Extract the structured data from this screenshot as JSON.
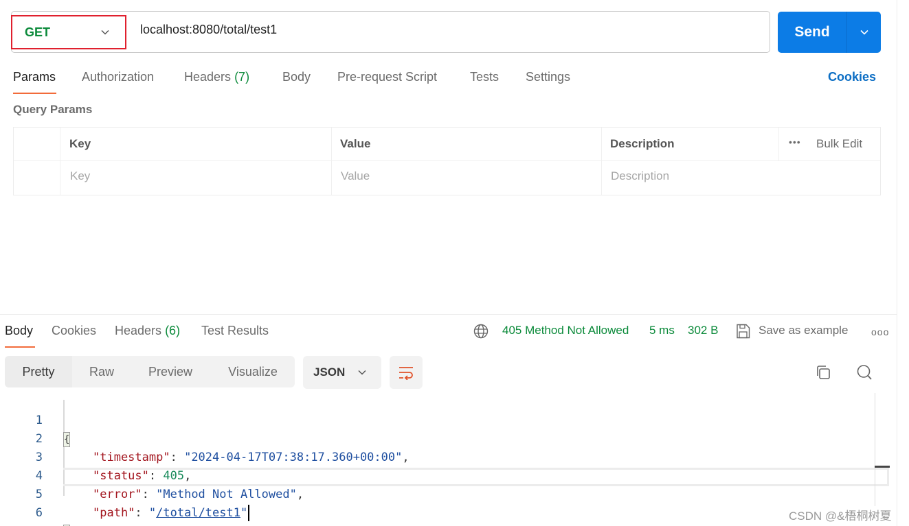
{
  "request": {
    "method": "GET",
    "url": "localhost:8080/total/test1",
    "send_label": "Send",
    "tabs": [
      {
        "label": "Params",
        "count": null,
        "active": true
      },
      {
        "label": "Authorization",
        "count": null,
        "active": false
      },
      {
        "label": "Headers",
        "count": "(7)",
        "active": false
      },
      {
        "label": "Body",
        "count": null,
        "active": false
      },
      {
        "label": "Pre-request Script",
        "count": null,
        "active": false
      },
      {
        "label": "Tests",
        "count": null,
        "active": false
      },
      {
        "label": "Settings",
        "count": null,
        "active": false
      }
    ],
    "cookies_link": "Cookies"
  },
  "params": {
    "section_title": "Query Params",
    "columns": [
      "Key",
      "Value",
      "Description"
    ],
    "bulk_edit": "Bulk Edit",
    "placeholders": {
      "key": "Key",
      "value": "Value",
      "description": "Description"
    }
  },
  "response": {
    "tabs": [
      {
        "label": "Body",
        "count": null,
        "active": true
      },
      {
        "label": "Cookies",
        "count": null,
        "active": false
      },
      {
        "label": "Headers",
        "count": "(6)",
        "active": false
      },
      {
        "label": "Test Results",
        "count": null,
        "active": false
      }
    ],
    "status": "405 Method Not Allowed",
    "time": "5 ms",
    "size": "302 B",
    "save_example": "Save as example",
    "view_modes": [
      "Pretty",
      "Raw",
      "Preview",
      "Visualize"
    ],
    "active_view": "Pretty",
    "format": "JSON",
    "code_lines": [
      {
        "n": "1"
      },
      {
        "n": "2",
        "key": "\"timestamp\"",
        "value": "\"2024-04-17T07:38:17.360+00:00\""
      },
      {
        "n": "3",
        "key": "\"status\"",
        "value": "405"
      },
      {
        "n": "4",
        "key": "\"error\"",
        "value": "\"Method Not Allowed\""
      },
      {
        "n": "5",
        "key": "\"path\"",
        "value": "/total/test1"
      },
      {
        "n": "6"
      }
    ]
  },
  "colors": {
    "accent": "#0c7ce6",
    "success": "#0b8a3a",
    "tab_underline": "#f26b3a",
    "method_highlight": "#e0202e"
  },
  "watermark": "CSDN @&梧桐树夏"
}
